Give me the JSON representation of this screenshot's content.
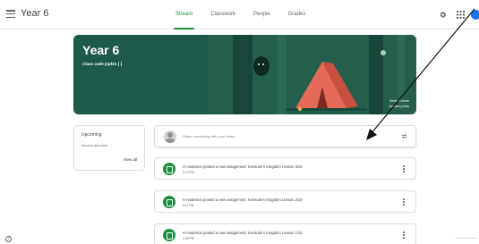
{
  "header": {
    "class_title": "Year 6",
    "tabs": [
      {
        "label": "Stream",
        "active": true
      },
      {
        "label": "Classwork",
        "active": false
      },
      {
        "label": "People",
        "active": false
      },
      {
        "label": "Grades",
        "active": false
      }
    ],
    "icons": [
      "menu-icon",
      "gear-icon",
      "apps-icon",
      "account-avatar"
    ]
  },
  "banner": {
    "title": "Year 6",
    "class_code": "Class code  jnpf2n  [ ]",
    "select_theme": "Select theme",
    "upload_photo": "Upload photo"
  },
  "upcoming": {
    "title": "Upcoming",
    "text": "No work due soon",
    "view_all": "View all"
  },
  "share": {
    "placeholder": "Share something with your class..."
  },
  "posts": [
    {
      "text": "H Anderson posted a new assignment: Kensuke's Kingdom Lesson 3/10",
      "time": "2:14 PM"
    },
    {
      "text": "H Anderson posted a new assignment: Kensuke's Kingdom Lesson 2/10",
      "time": "2:11 PM"
    },
    {
      "text": "H Anderson posted a new assignment: Kensuke's Kingdom Lesson 1/10",
      "time": "2:05 PM"
    }
  ],
  "colors": {
    "accent": "#1e8e3e",
    "banner": "#1e5a4a",
    "tent": "#d9534f"
  }
}
